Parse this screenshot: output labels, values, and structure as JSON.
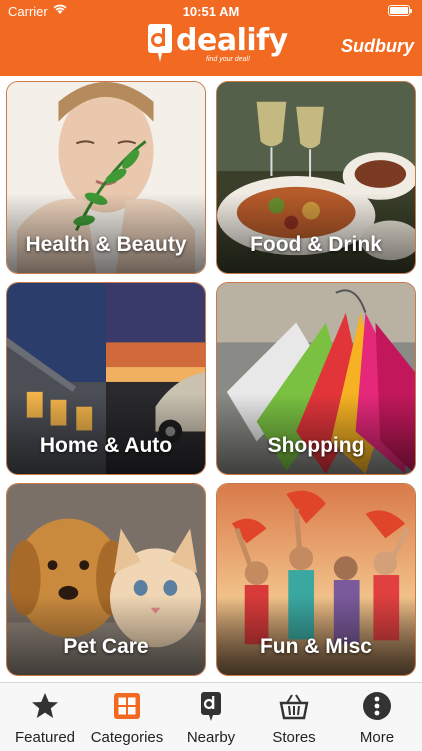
{
  "status_bar": {
    "carrier": "Carrier",
    "time": "10:51 AM"
  },
  "header": {
    "logo_text": "dealify",
    "tagline": "find your deal!",
    "city": "Sudbury"
  },
  "categories": [
    {
      "label": "Health & Beauty"
    },
    {
      "label": "Food & Drink"
    },
    {
      "label": "Home & Auto"
    },
    {
      "label": "Shopping"
    },
    {
      "label": "Pet Care"
    },
    {
      "label": "Fun & Misc"
    }
  ],
  "tabs": [
    {
      "label": "Featured",
      "icon": "star-icon"
    },
    {
      "label": "Categories",
      "icon": "grid-icon",
      "selected": true
    },
    {
      "label": "Nearby",
      "icon": "location-icon"
    },
    {
      "label": "Stores",
      "icon": "basket-icon"
    },
    {
      "label": "More",
      "icon": "more-icon"
    }
  ],
  "colors": {
    "brand": "#f26a21",
    "tab_active": "#f26a21",
    "tab_inactive": "#333333"
  }
}
